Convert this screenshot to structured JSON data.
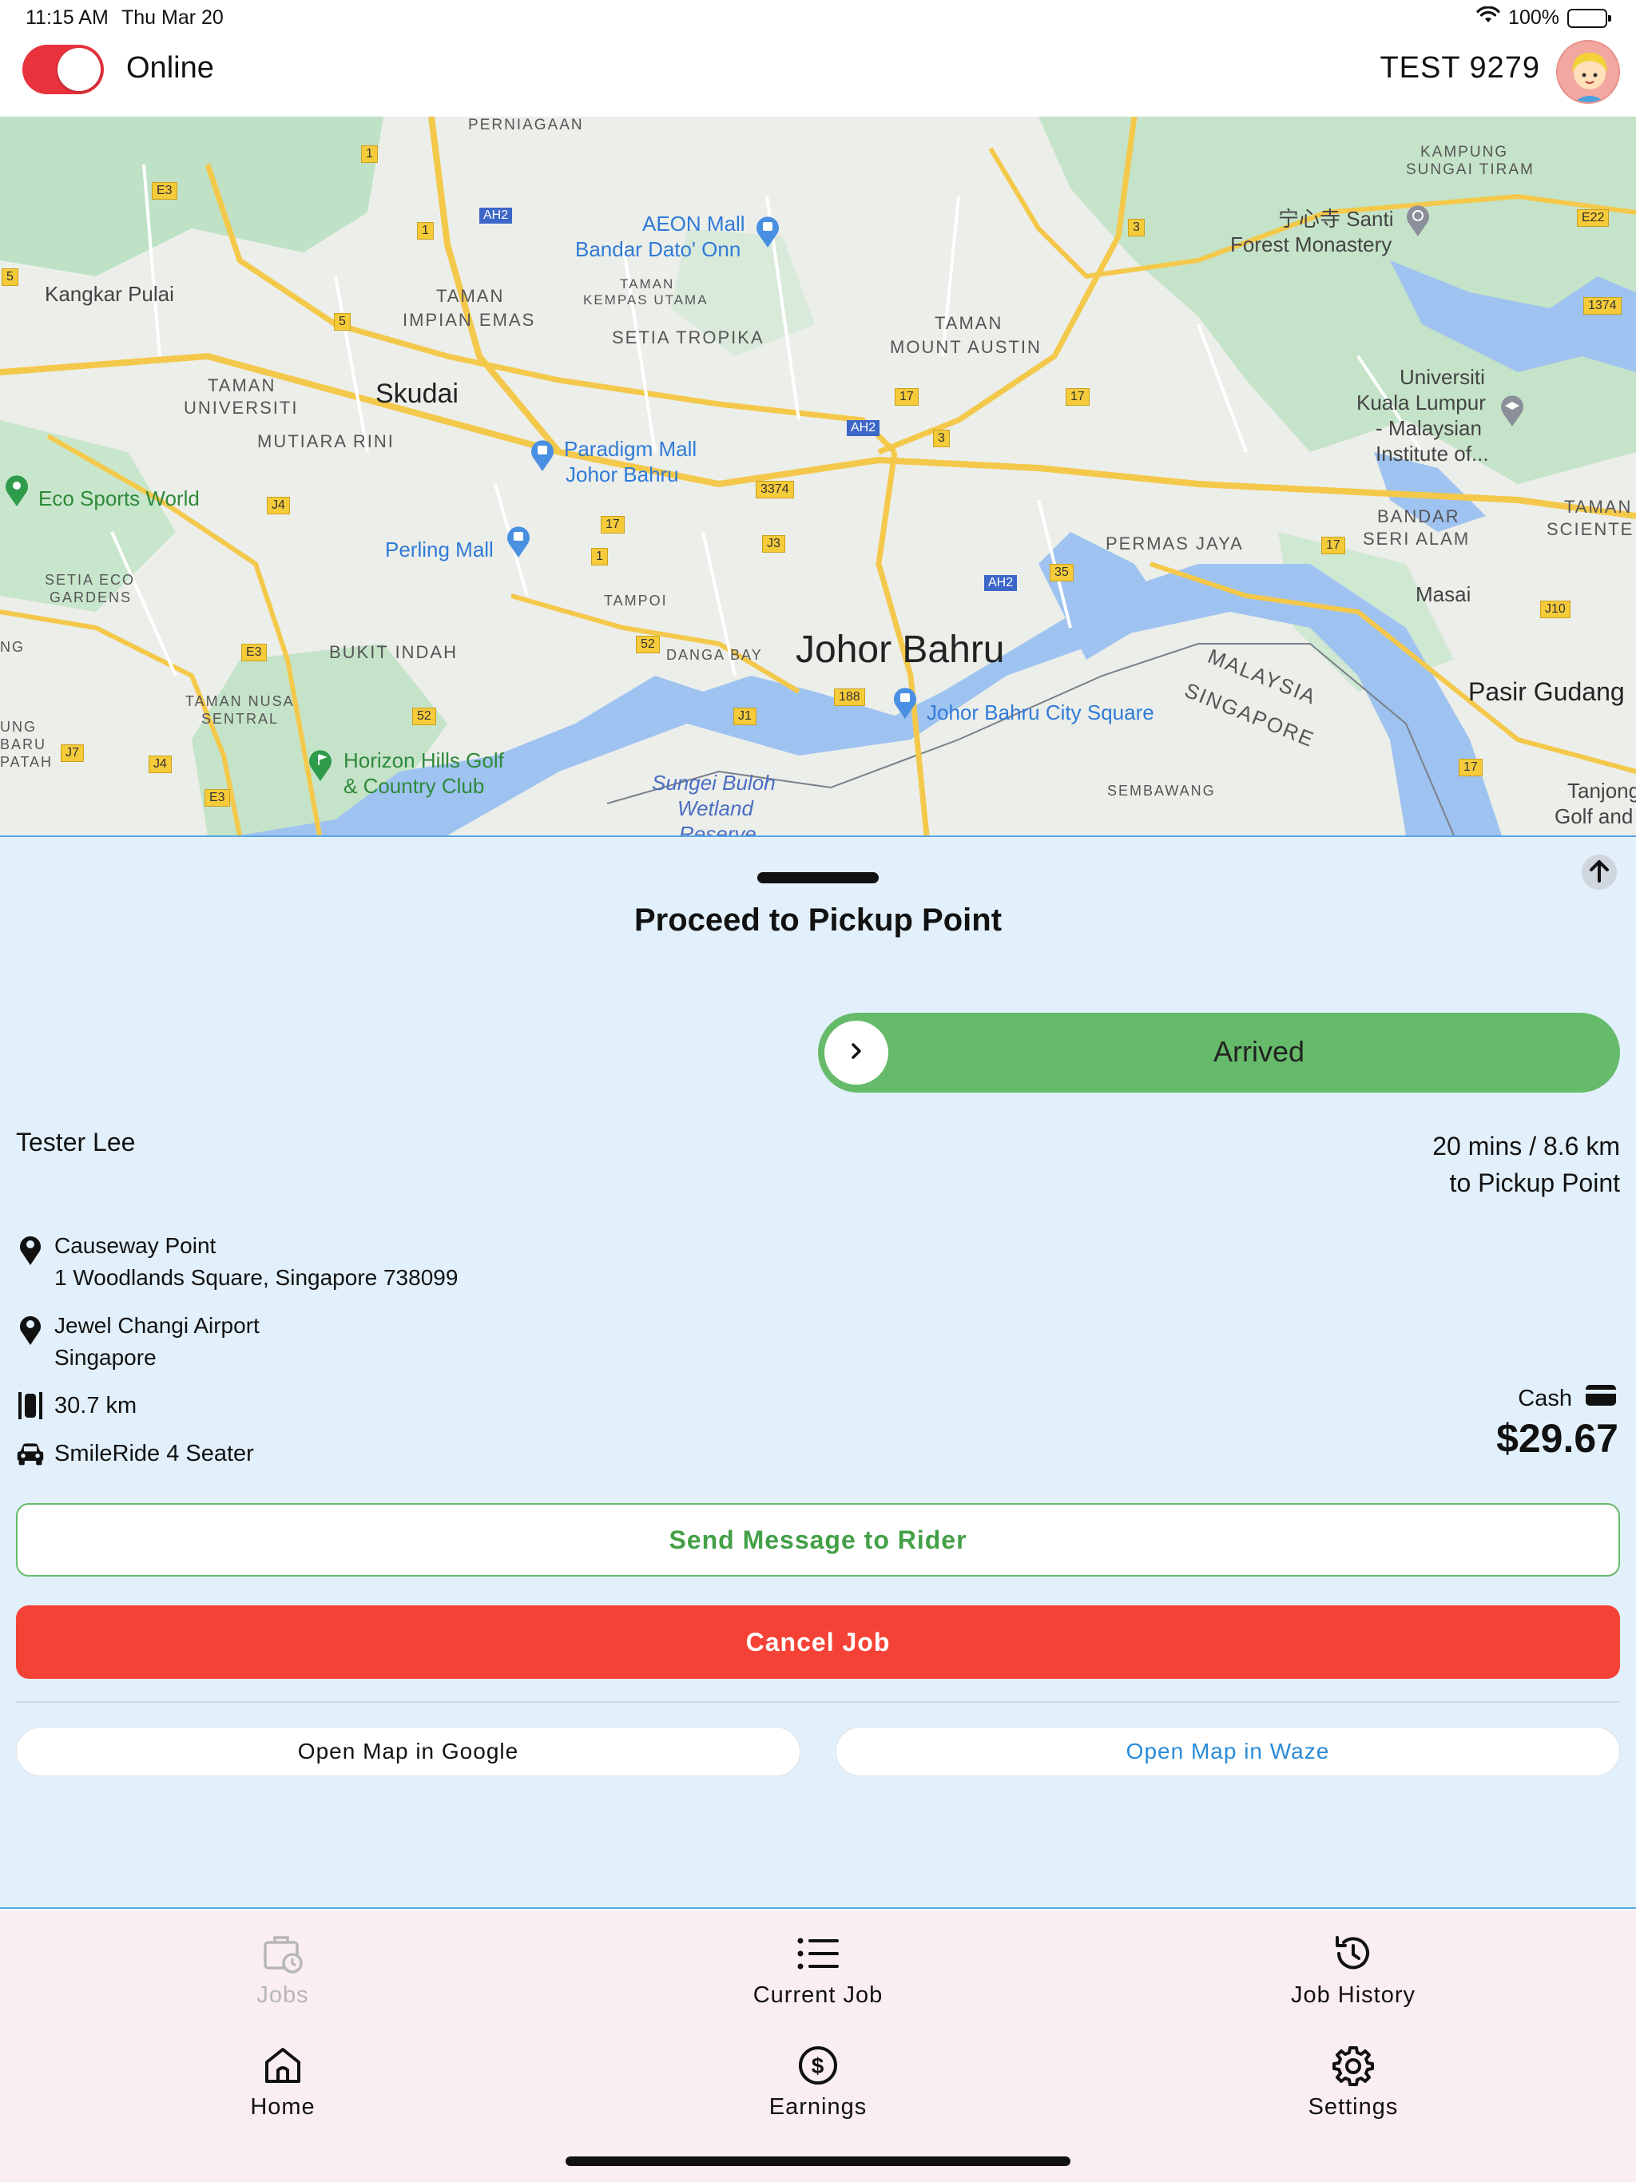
{
  "status_bar": {
    "time": "11:15 AM",
    "date": "Thu Mar 20",
    "battery": "100%"
  },
  "header": {
    "status_label": "Online",
    "driver_name": "TEST 9279"
  },
  "map": {
    "labels": {
      "perniagaan": "PERNIAGAAN",
      "kampung": "KAMPUNG",
      "sungai_tiram": "SUNGAI TIRAM",
      "kangkar_pulai": "Kangkar Pulai",
      "taman_impian_1": "TAMAN",
      "taman_impian_2": "IMPIAN EMAS",
      "taman_kempas_1": "TAMAN",
      "taman_kempas_2": "KEMPAS UTAMA",
      "setia_tropika": "SETIA TROPIKA",
      "taman_mount_1": "TAMAN",
      "taman_mount_2": "MOUNT AUSTIN",
      "taman_univ_1": "TAMAN",
      "taman_univ_2": "UNIVERSITI",
      "skudai": "Skudai",
      "mutiara_rini": "MUTIARA RINI",
      "permas_jaya": "PERMAS JAYA",
      "bandar_seri_1": "BANDAR",
      "bandar_seri_2": "SERI ALAM",
      "taman_scien_1": "TAMAN",
      "taman_scien_2": "SCIENTE",
      "setia_eco_1": "SETIA ECO",
      "setia_eco_2": "GARDENS",
      "tampoi": "TAMPOI",
      "masai": "Masai",
      "ng": "NG",
      "bukit_indah": "BUKIT INDAH",
      "danga_bay": "DANGA BAY",
      "johor_bahru": "Johor Bahru",
      "pasir_gudang": "Pasir Gudang",
      "malaysia": "MALAYSIA",
      "singapore": "SINGAPORE",
      "taman_nusa_1": "TAMAN NUSA",
      "taman_nusa_2": "SENTRAL",
      "ung_baru_1": "UNG",
      "ung_baru_2": "BARU",
      "ung_baru_3": "PATAH",
      "sembawang": "SEMBAWANG",
      "tanjong_1": "Tanjong",
      "tanjong_2": "Golf and"
    },
    "pois": {
      "aeon_1": "AEON Mall",
      "aeon_2": "Bandar Dato' Onn",
      "santi_1": "宁心寺 Santi",
      "santi_2": "Forest Monastery",
      "univ_1": "Universiti",
      "univ_2": "Kuala Lumpur",
      "univ_3": "- Malaysian",
      "univ_4": "Institute of...",
      "paradigm_1": "Paradigm Mall",
      "paradigm_2": "Johor Bahru",
      "eco_sports": "Eco Sports World",
      "perling": "Perling Mall",
      "jb_city_square": "Johor Bahru City Square",
      "horizon_1": "Horizon Hills Golf",
      "horizon_2": "& Country Club",
      "sungei_1": "Sungei Buloh",
      "sungei_2": "Wetland",
      "sungei_3": "Reserve"
    },
    "shields": [
      "1",
      "E3",
      "AH2",
      "1",
      "5",
      "5",
      "3",
      "E22",
      "1374",
      "17",
      "17",
      "AH2",
      "3",
      "3374",
      "J4",
      "17",
      "1",
      "J3",
      "AH2",
      "35",
      "17",
      "J10",
      "E3",
      "52",
      "188",
      "J1",
      "52",
      "J7",
      "J4",
      "E3",
      "17"
    ]
  },
  "job": {
    "title": "Proceed to Pickup Point",
    "slide_label": "Arrived",
    "rider_name": "Tester Lee",
    "eta_line1": "20 mins / 8.6 km",
    "eta_line2": "to Pickup Point",
    "pickup_name": "Causeway Point",
    "pickup_address": "1 Woodlands Square, Singapore 738099",
    "dropoff_name": "Jewel Changi Airport",
    "dropoff_address": "Singapore",
    "distance": "30.7 km",
    "vehicle": "SmileRide 4 Seater",
    "payment_method": "Cash",
    "price": "$29.67"
  },
  "actions": {
    "send_message": "Send Message to Rider",
    "cancel_job": "Cancel Job",
    "open_google": "Open Map in Google",
    "open_waze": "Open Map in Waze"
  },
  "nav": {
    "jobs": "Jobs",
    "current_job": "Current Job",
    "job_history": "Job History",
    "home": "Home",
    "earnings": "Earnings",
    "settings": "Settings"
  },
  "colors": {
    "toggle_on": "#e8323c",
    "arrived_green": "#66bb6a",
    "cancel_red": "#f44336",
    "panel_bg": "#e2f0fb",
    "nav_bg": "#fbeef2",
    "waze_link": "#2a8bd8"
  }
}
